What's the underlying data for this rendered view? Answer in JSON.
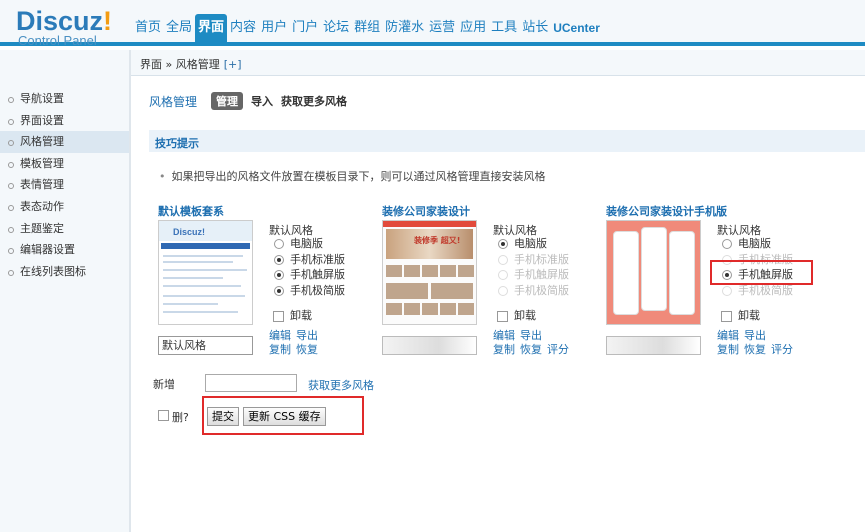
{
  "logo": {
    "brand": "Discuz",
    "excl": "!",
    "sub": "Control Panel"
  },
  "nav": [
    "首页",
    "全局",
    "界面",
    "内容",
    "用户",
    "门户",
    "论坛",
    "群组",
    "防灌水",
    "运营",
    "应用",
    "工具",
    "站长",
    "UCenter"
  ],
  "nav_active_index": 2,
  "breadcrumb": {
    "path": "界面 » 风格管理",
    "plus": "[+]"
  },
  "sidebar": [
    "导航设置",
    "界面设置",
    "风格管理",
    "模板管理",
    "表情管理",
    "表态动作",
    "主题鉴定",
    "编辑器设置",
    "在线列表图标"
  ],
  "sidebar_active_index": 2,
  "page": {
    "title": "风格管理",
    "tabs": [
      "管理",
      "导入",
      "获取更多风格"
    ]
  },
  "tips": {
    "title": "技巧提示",
    "text": "如果把导出的风格文件放置在模板目录下，则可以通过风格管理直接安装风格"
  },
  "styles": [
    {
      "name": "默认模板套系",
      "default_label": "默认风格",
      "options": [
        "电脑版",
        "手机标准版",
        "手机触屏版",
        "手机极简版"
      ],
      "uninstall": "卸载",
      "input_value": "默认风格",
      "links_row1": [
        "编辑",
        "导出"
      ],
      "links_row2": [
        "复制",
        "恢复"
      ]
    },
    {
      "name": "装修公司家装设计",
      "default_label": "默认风格",
      "options": [
        "电脑版",
        "手机标准版",
        "手机触屏版",
        "手机极简版"
      ],
      "uninstall": "卸载",
      "input_value": "",
      "banner_text": "装修季 超又!",
      "links_row1": [
        "编辑",
        "导出"
      ],
      "links_row2": [
        "复制",
        "恢复",
        "评分"
      ]
    },
    {
      "name": "装修公司家装设计手机版",
      "default_label": "默认风格",
      "options": [
        "电脑版",
        "手机标准版",
        "手机触屏版",
        "手机极简版"
      ],
      "uninstall": "卸载",
      "input_value": "",
      "links_row1": [
        "编辑",
        "导出"
      ],
      "links_row2": [
        "复制",
        "恢复",
        "评分"
      ]
    }
  ],
  "form": {
    "new_label": "新增",
    "get_more": "获取更多风格",
    "delete_label": "删?",
    "submit": "提交",
    "refresh_css": "更新 CSS 缓存"
  },
  "colors": {
    "accent": "#1e8bc3",
    "link": "#1e6fb0",
    "highlight_box": "#e02a2a"
  }
}
